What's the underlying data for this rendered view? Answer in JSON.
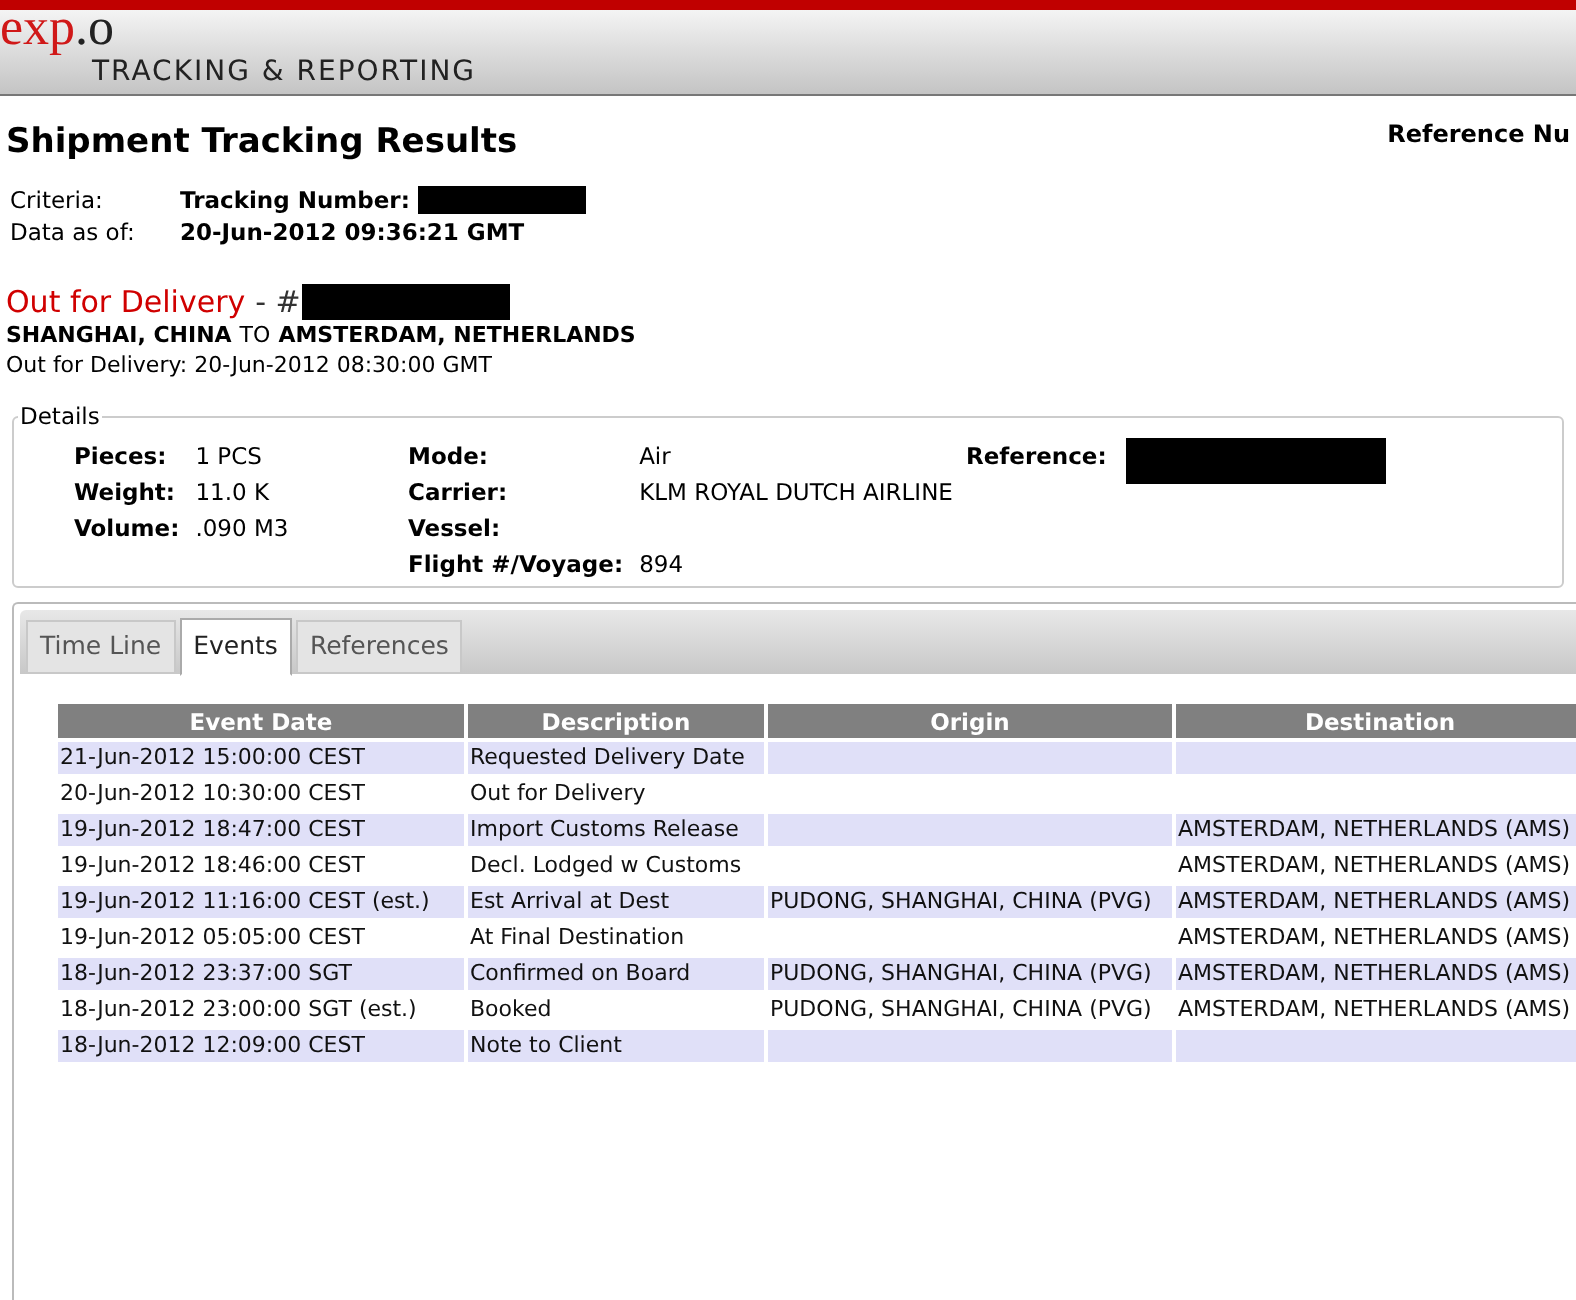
{
  "header": {
    "logo_main": "exp",
    "logo_suffix": ".o",
    "subtitle": "TRACKING & REPORTING"
  },
  "page_title": "Shipment Tracking Results",
  "reference_label": "Reference Nu",
  "criteria": [
    {
      "label": "Criteria:",
      "value": "Tracking Number:",
      "redacted": true
    },
    {
      "label": "Data as of:",
      "value": "20-Jun-2012 09:36:21 GMT",
      "redacted": false
    }
  ],
  "status": {
    "title": "Out for Delivery",
    "separator": "- #",
    "origin": "SHANGHAI, CHINA",
    "connector": "TO",
    "destination": "AMSTERDAM, NETHERLANDS",
    "note": "Out for Delivery: 20-Jun-2012 08:30:00 GMT"
  },
  "details": {
    "legend": "Details",
    "col_1": [
      {
        "label": "Pieces:",
        "value": "1 PCS"
      },
      {
        "label": "Weight:",
        "value": "11.0 K"
      },
      {
        "label": "Volume:",
        "value": ".090 M3"
      }
    ],
    "col_2": [
      {
        "label": "Mode:",
        "value": "Air"
      },
      {
        "label": "Carrier:",
        "value": "KLM ROYAL DUTCH AIRLINE"
      },
      {
        "label": "Vessel:"
      },
      {
        "label": "Flight #/Voyage:",
        "value": "894"
      }
    ],
    "reference_label": "Reference:"
  },
  "tabs": [
    {
      "label": "Time Line",
      "selected": false
    },
    {
      "label": "Events",
      "selected": true
    },
    {
      "label": "References",
      "selected": false
    }
  ],
  "table": {
    "columns": [
      "Event Date",
      "Description",
      "Origin",
      "Destination"
    ],
    "rows": [
      [
        "21-Jun-2012 15:00:00 CEST",
        "Requested Delivery Date",
        "",
        ""
      ],
      [
        "20-Jun-2012 10:30:00 CEST",
        "Out for Delivery",
        "",
        ""
      ],
      [
        "19-Jun-2012 18:47:00 CEST",
        "Import Customs Release",
        "",
        "AMSTERDAM, NETHERLANDS (AMS)"
      ],
      [
        "19-Jun-2012 18:46:00 CEST",
        "Decl. Lodged w Customs",
        "",
        "AMSTERDAM, NETHERLANDS (AMS)"
      ],
      [
        "19-Jun-2012 11:16:00 CEST (est.)",
        "Est Arrival at Dest",
        "PUDONG, SHANGHAI, CHINA (PVG)",
        "AMSTERDAM, NETHERLANDS (AMS)"
      ],
      [
        "19-Jun-2012 05:05:00 CEST",
        "At Final Destination",
        "",
        "AMSTERDAM, NETHERLANDS (AMS)"
      ],
      [
        "18-Jun-2012 23:37:00 SGT",
        "Confirmed on Board",
        "PUDONG, SHANGHAI, CHINA (PVG)",
        "AMSTERDAM, NETHERLANDS (AMS)"
      ],
      [
        "18-Jun-2012 23:00:00 SGT (est.)",
        "Booked",
        "PUDONG, SHANGHAI, CHINA (PVG)",
        "AMSTERDAM, NETHERLANDS (AMS)"
      ],
      [
        "18-Jun-2012 12:09:00 CEST",
        "Note to Client",
        "",
        ""
      ]
    ]
  }
}
